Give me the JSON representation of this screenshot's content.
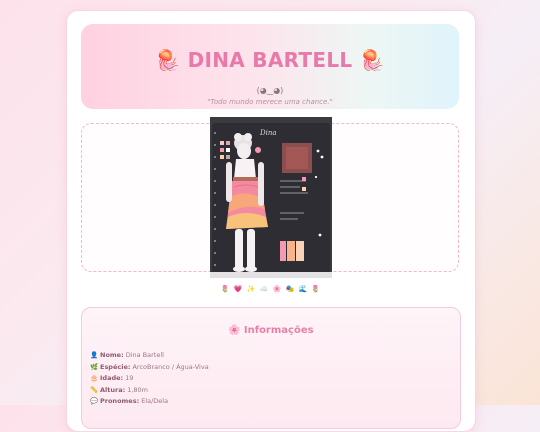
{
  "header": {
    "title_icon": "🪼",
    "title": "DINA BARTELL",
    "kaomoji": "(◕‿◕)",
    "quote": "\"Todo mundo merece uma chance.\""
  },
  "gallery": {
    "image_label": "Dina",
    "emoji_row": "🌷 💗 ✨ ☁️ 🌸 🎭 🌊 🌷"
  },
  "info": {
    "icon": "🌸",
    "title": "Informações",
    "fields": [
      {
        "icon": "👤",
        "label": "Nome:",
        "value": "Dina Bartell"
      },
      {
        "icon": "🌿",
        "label": "Espécie:",
        "value": "ArcoBranco / Água-Viva"
      },
      {
        "icon": "🎂",
        "label": "Idade:",
        "value": "19"
      },
      {
        "icon": "📏",
        "label": "Altura:",
        "value": "1,80m"
      },
      {
        "icon": "💬",
        "label": "Pronomes:",
        "value": "Ela/Dela"
      }
    ]
  },
  "colors": {
    "accent": "#e879a8",
    "card_border": "#f8cbd9",
    "dress": "#f48aa0"
  }
}
